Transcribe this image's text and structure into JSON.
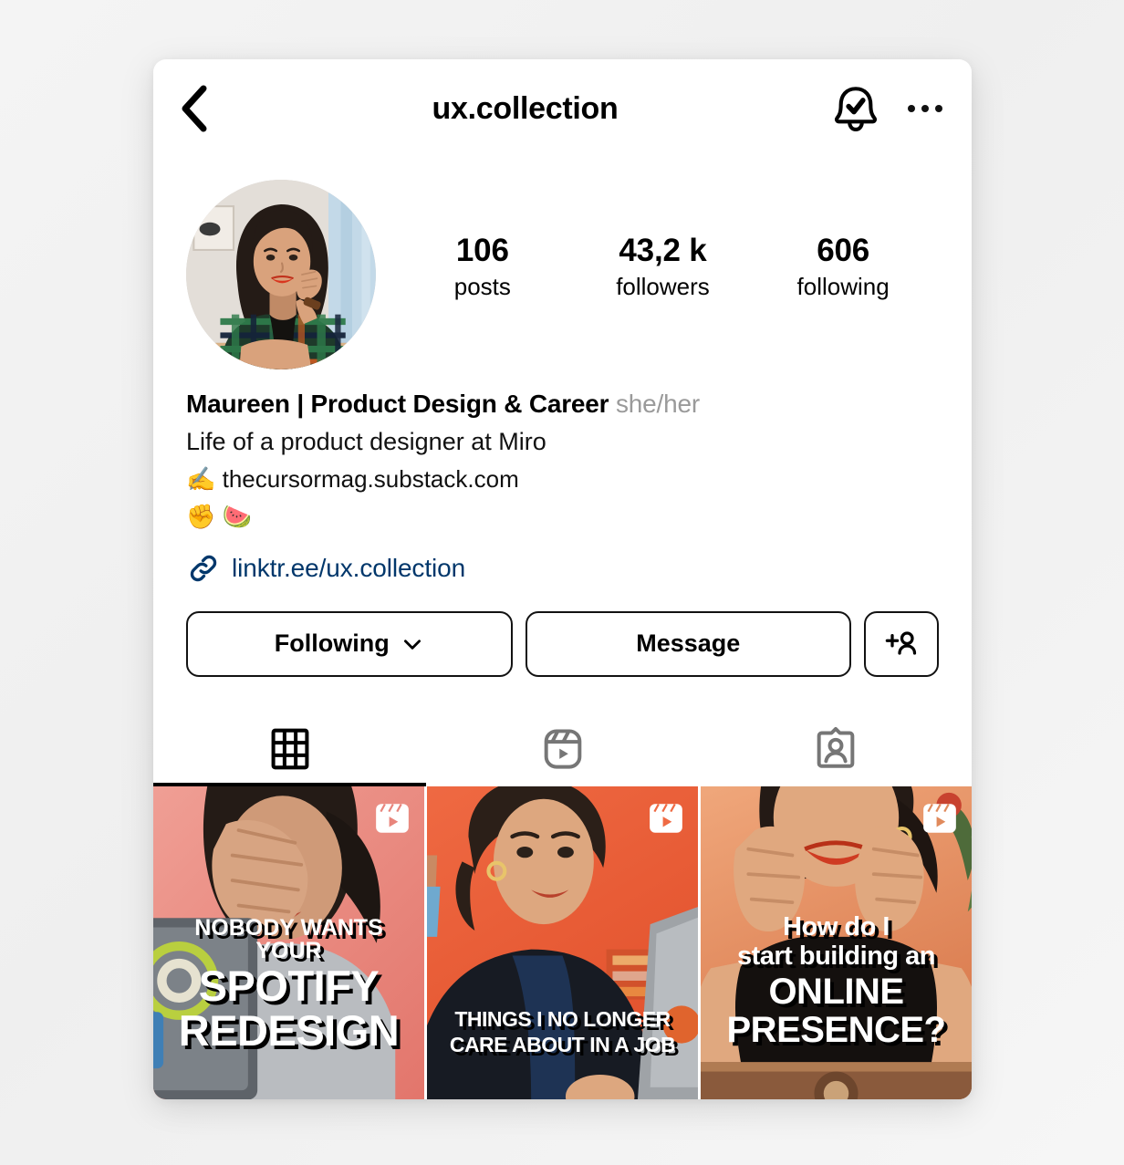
{
  "topbar": {
    "back_icon": "chevron-left-icon",
    "username": "ux.collection",
    "notify_icon": "bell-check-icon",
    "more_icon": "more-options-icon"
  },
  "profile": {
    "avatar_alt": "profile-photo",
    "stats": [
      {
        "num": "106",
        "label": "posts"
      },
      {
        "num": "43,2 k",
        "label": "followers"
      },
      {
        "num": "606",
        "label": "following"
      }
    ],
    "display_name": "Maureen | Product Design & Career",
    "pronouns": "she/her",
    "bio_lines": [
      "Life of a product designer at Miro",
      "✍️ thecursormag.substack.com",
      "✊ 🍉"
    ],
    "link": {
      "icon": "link-icon",
      "text": "linktr.ee/ux.collection",
      "color": "#00376b"
    }
  },
  "actions": {
    "following_label": "Following",
    "following_chevron": "chevron-down-icon",
    "message_label": "Message",
    "add_person_icon": "add-person-icon"
  },
  "tabs": [
    {
      "name": "grid",
      "icon": "grid-icon",
      "active": true
    },
    {
      "name": "reels",
      "icon": "reels-icon",
      "active": false
    },
    {
      "name": "tagged",
      "icon": "tagged-person-icon",
      "active": false
    }
  ],
  "posts": [
    {
      "type": "reel",
      "badge_icon": "reels-badge-icon",
      "caption_lines": [
        "NOBODY WANTS YOUR",
        "SPOTIFY",
        "REDESIGN"
      ],
      "bg_color": "#e8857c"
    },
    {
      "type": "reel",
      "badge_icon": "reels-badge-icon",
      "caption_lines": [
        "THINGS I NO LONGER",
        "CARE ABOUT IN A JOB"
      ],
      "bg_color": "#f06640"
    },
    {
      "type": "reel",
      "badge_icon": "reels-badge-icon",
      "caption_lines": [
        "How do I",
        "start building an",
        "ONLINE",
        "PRESENCE?"
      ],
      "bg_color": "#e98a63"
    }
  ]
}
